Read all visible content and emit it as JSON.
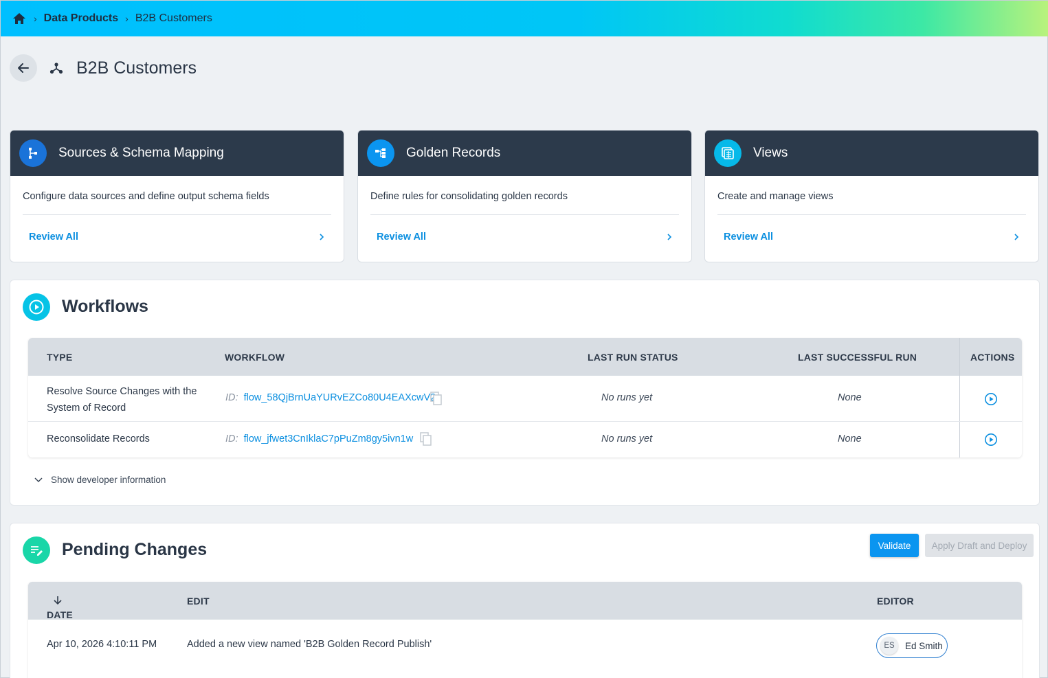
{
  "breadcrumb": {
    "home_icon": "home-icon",
    "items": [
      "Data Products",
      "B2B Customers"
    ],
    "separator": "›"
  },
  "header": {
    "title": "B2B Customers",
    "back_icon": "arrow-left-icon",
    "title_icon": "data-product-icon"
  },
  "cards": [
    {
      "title": "Sources & Schema Mapping",
      "description": "Configure data sources and define output schema fields",
      "link": "Review All",
      "icon": "schema-mapping-icon",
      "icon_color": "#1a73d9"
    },
    {
      "title": "Golden Records",
      "description": "Define rules for consolidating golden records",
      "link": "Review All",
      "icon": "golden-records-icon",
      "icon_color": "#0b95f0"
    },
    {
      "title": "Views",
      "description": "Create and manage views",
      "link": "Review All",
      "icon": "views-icon",
      "icon_color": "#06b9e9"
    }
  ],
  "workflows": {
    "title": "Workflows",
    "icon": "play-circle-icon",
    "columns": [
      "TYPE",
      "WORKFLOW",
      "LAST RUN STATUS",
      "LAST SUCCESSFUL RUN",
      "ACTIONS"
    ],
    "rows": [
      {
        "type_line1": "Resolve Source Changes with the",
        "type_line2": "System of Record",
        "id_label": "ID:",
        "workflow_id": "flow_58QjBrnUaYURvEZCo80U4EAXcwV2",
        "last_run_status": "No runs yet",
        "last_successful_run": "None"
      },
      {
        "type_line1": "Reconsolidate Records",
        "type_line2": "",
        "id_label": "ID:",
        "workflow_id": "flow_jfwet3CnIklaC7pPuZm8gy5ivn1w",
        "last_run_status": "No runs yet",
        "last_successful_run": "None"
      }
    ],
    "dev_info_label": "Show developer information"
  },
  "pending": {
    "title": "Pending Changes",
    "icon": "edit-list-icon",
    "validate_label": "Validate",
    "apply_label": "Apply Draft and Deploy",
    "columns": [
      "DATE",
      "EDIT",
      "EDITOR"
    ],
    "rows": [
      {
        "date": "Apr 10, 2026 4:10:11 PM",
        "edit": "Added a new view named 'B2B Golden Record Publish'",
        "editor_initials": "ES",
        "editor_name": "Ed Smith"
      }
    ]
  },
  "colors": {
    "accent": "#0b8fe0",
    "card_header": "#2c3a4b",
    "workflow_icon": "#06c3e6",
    "pending_icon": "#19d6a8"
  }
}
